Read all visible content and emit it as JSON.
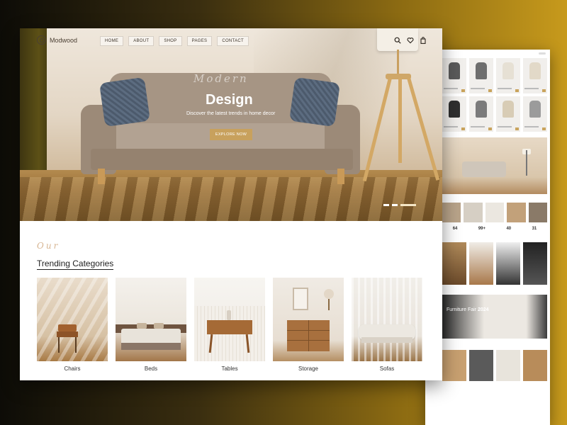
{
  "brand": {
    "name": "Modwood"
  },
  "nav": {
    "items": [
      "HOME",
      "ABOUT",
      "SHOP",
      "PAGES",
      "CONTACT"
    ]
  },
  "hero": {
    "script": "Modern",
    "title": "Design",
    "subtitle": "Discover the latest trends in home decor",
    "cta": "EXPLORE NOW"
  },
  "categories": {
    "script": "Our",
    "title": "Trending Categories",
    "items": [
      {
        "label": "Chairs"
      },
      {
        "label": "Beds"
      },
      {
        "label": "Tables"
      },
      {
        "label": "Storage"
      },
      {
        "label": "Sofas"
      }
    ]
  },
  "secondary_page": {
    "stats": [
      "64",
      "99+",
      "40",
      "31"
    ],
    "banner": {
      "title": "Furniture Fair",
      "year": "2024"
    }
  },
  "colors": {
    "accent": "#c8a15d",
    "text": "#222222"
  }
}
